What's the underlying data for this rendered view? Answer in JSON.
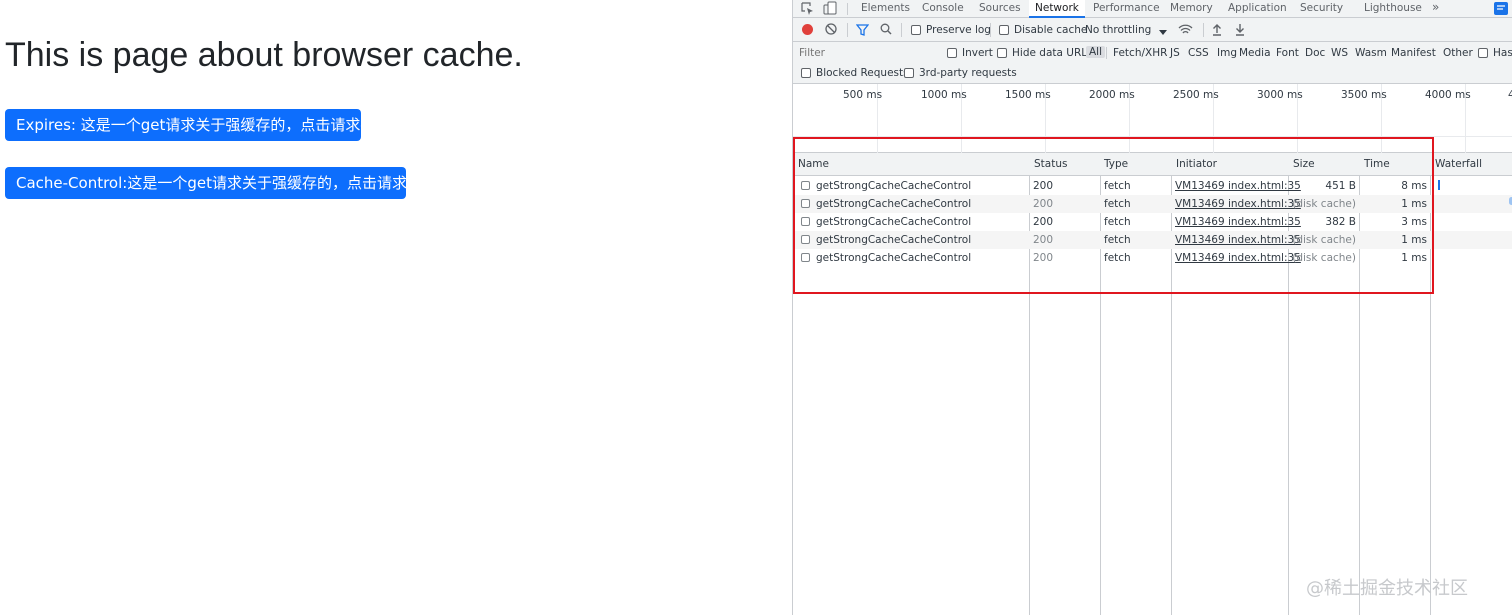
{
  "page": {
    "title": "This is page about browser cache.",
    "buttons": {
      "expires": "Expires: 这是一个get请求关于强缓存的，点击请求接口",
      "cache_control": "Cache-Control:这是一个get请求关于强缓存的，点击请求接口"
    }
  },
  "devtools": {
    "tabs": [
      "Elements",
      "Console",
      "Sources",
      "Network",
      "Performance",
      "Memory",
      "Application",
      "Security",
      "Lighthouse"
    ],
    "more_tabs": "»",
    "toolbar": {
      "preserve_log": "Preserve log",
      "disable_cache": "Disable cache",
      "throttling": "No throttling"
    },
    "filter": {
      "placeholder": "Filter",
      "invert": "Invert",
      "hide_data_urls": "Hide data URLs",
      "types": [
        "All",
        "Fetch/XHR",
        "JS",
        "CSS",
        "Img",
        "Media",
        "Font",
        "Doc",
        "WS",
        "Wasm",
        "Manifest",
        "Other"
      ],
      "has": "Has",
      "blocked_requests": "Blocked Requests",
      "third_party": "3rd-party requests"
    },
    "overview_ticks": [
      "500 ms",
      "1000 ms",
      "1500 ms",
      "2000 ms",
      "2500 ms",
      "3000 ms",
      "3500 ms",
      "4000 ms",
      "4"
    ],
    "columns": {
      "name": "Name",
      "status": "Status",
      "type": "Type",
      "initiator": "Initiator",
      "size": "Size",
      "time": "Time",
      "waterfall": "Waterfall"
    },
    "requests": [
      {
        "name": "getStrongCacheCacheControl",
        "status": "200",
        "type": "fetch",
        "initiator": "VM13469 index.html:35",
        "size": "451 B",
        "time": "8 ms"
      },
      {
        "name": "getStrongCacheCacheControl",
        "status": "200",
        "type": "fetch",
        "initiator": "VM13469 index.html:35",
        "size": "(disk cache)",
        "time": "1 ms"
      },
      {
        "name": "getStrongCacheCacheControl",
        "status": "200",
        "type": "fetch",
        "initiator": "VM13469 index.html:35",
        "size": "382 B",
        "time": "3 ms"
      },
      {
        "name": "getStrongCacheCacheControl",
        "status": "200",
        "type": "fetch",
        "initiator": "VM13469 index.html:35",
        "size": "(disk cache)",
        "time": "1 ms"
      },
      {
        "name": "getStrongCacheCacheControl",
        "status": "200",
        "type": "fetch",
        "initiator": "VM13469 index.html:35",
        "size": "(disk cache)",
        "time": "1 ms"
      }
    ]
  },
  "watermark": "@稀土掘金技术社区",
  "colors": {
    "button_blue": "#0d6efd",
    "highlight_red": "#e0161f",
    "record_red": "#e0403b",
    "devtools_accent": "#1a73e8"
  }
}
